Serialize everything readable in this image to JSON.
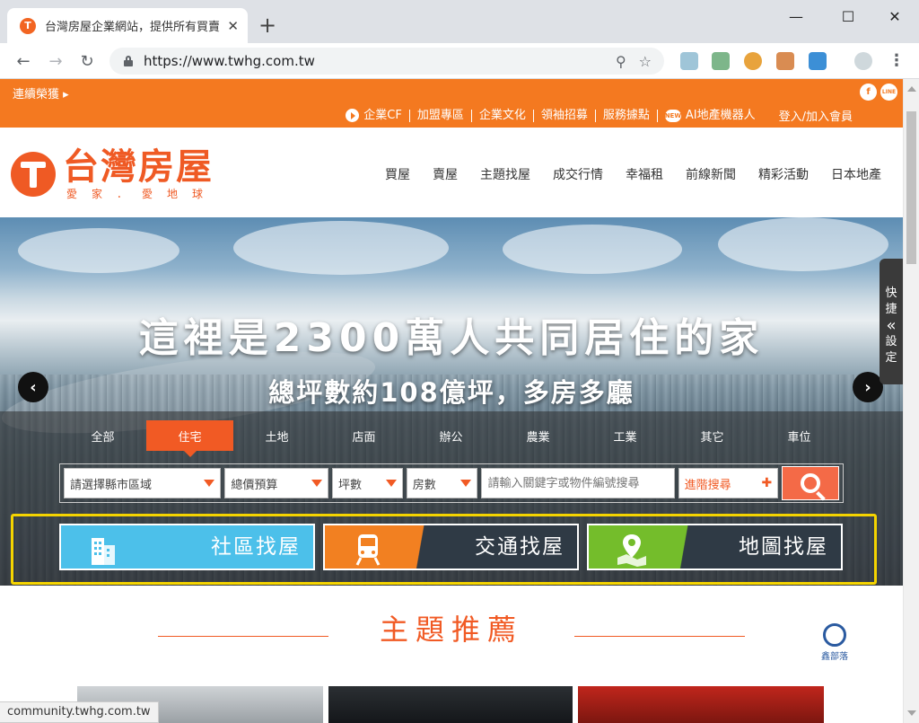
{
  "browser": {
    "tab_title": "台灣房屋企業網站，提供所有買賣",
    "url": "https://www.twhg.com.tw",
    "status_url": "community.twhg.com.tw"
  },
  "topbar": {
    "marquee": "連續榮獲 ▸",
    "social": [
      "f",
      "LINE"
    ],
    "links": [
      "企業CF",
      "加盟專區",
      "企業文化",
      "領袖招募",
      "服務據點",
      "AI地產機器人"
    ],
    "login": "登入/加入會員"
  },
  "logo": {
    "name": "台灣房屋",
    "slogan": "愛家．愛地球"
  },
  "mainnav": [
    "買屋",
    "賣屋",
    "主題找屋",
    "成交行情",
    "幸福租",
    "前線新聞",
    "精彩活動",
    "日本地產"
  ],
  "hero": {
    "title": "這裡是2300萬人共同居住的家",
    "subtitle": "總坪數約108億坪，多房多廳",
    "quickset": [
      "快",
      "捷",
      "«",
      "設",
      "定"
    ]
  },
  "search": {
    "tabs": [
      "全部",
      "住宅",
      "土地",
      "店面",
      "辦公",
      "農業",
      "工業",
      "其它",
      "車位"
    ],
    "active_tab": "住宅",
    "region": "請選擇縣市區域",
    "price": "總價預算",
    "area": "坪數",
    "rooms": "房數",
    "keyword_placeholder": "請輸入關鍵字或物件編號搜尋",
    "advanced": "進階搜尋"
  },
  "finders": {
    "community": "社區找屋",
    "transit": "交通找屋",
    "map": "地圖找屋"
  },
  "section": {
    "title": "主題推薦"
  },
  "watermark": "鑫部落",
  "colors": {
    "brand_orange": "#f47920",
    "highlight": "#f5d400",
    "community": "#4cc0ea",
    "transit": "#f28021",
    "map": "#74bd2b"
  }
}
